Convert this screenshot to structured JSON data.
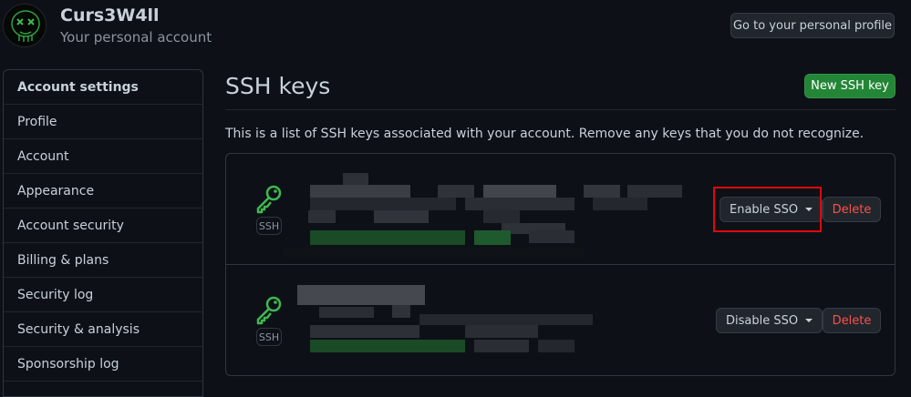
{
  "header": {
    "username": "Curs3W4ll",
    "subtitle": "Your personal account",
    "profile_button": "Go to your personal profile",
    "avatar_icon": "skull-avatar-icon"
  },
  "sidebar": {
    "items": [
      {
        "label": "Account settings"
      },
      {
        "label": "Profile"
      },
      {
        "label": "Account"
      },
      {
        "label": "Appearance"
      },
      {
        "label": "Account security"
      },
      {
        "label": "Billing & plans"
      },
      {
        "label": "Security log"
      },
      {
        "label": "Security & analysis"
      },
      {
        "label": "Sponsorship log"
      }
    ]
  },
  "main": {
    "title": "SSH keys",
    "new_key_button": "New SSH key",
    "description": "This is a list of SSH keys associated with your account. Remove any keys that you do not recognize.",
    "keys": [
      {
        "badge": "SSH",
        "sso_button": "Enable SSO",
        "delete_button": "Delete",
        "icon": "key-icon"
      },
      {
        "badge": "SSH",
        "sso_button": "Disable SSO",
        "delete_button": "Delete",
        "icon": "key-icon"
      }
    ]
  },
  "colors": {
    "background": "#0d1117",
    "accent_green": "#238636",
    "key_icon_green": "#3fb950",
    "danger": "#f85149",
    "highlight_red": "#e0080c"
  }
}
